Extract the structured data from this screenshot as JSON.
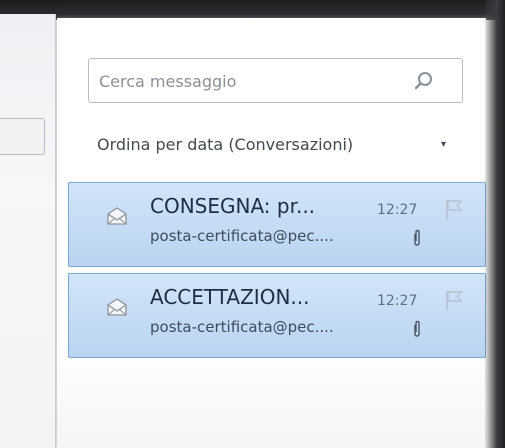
{
  "search": {
    "placeholder": "Cerca messaggio",
    "icon": "search-icon"
  },
  "sort": {
    "label": "Ordina per data (Conversazioni)",
    "arrow": "▾"
  },
  "messages": [
    {
      "subject": "CONSEGNA: pr...",
      "sender": "posta-certificata@pec....",
      "time": "12:27",
      "has_attachment": true,
      "icon": "envelope-open-icon"
    },
    {
      "subject": "ACCETTAZION...",
      "sender": "posta-certificata@pec....",
      "time": "12:27",
      "has_attachment": true,
      "icon": "envelope-open-icon"
    }
  ],
  "colors": {
    "selection": "#c3daf4",
    "selection_border": "#7ea6d3",
    "text": "#1d2d44"
  }
}
